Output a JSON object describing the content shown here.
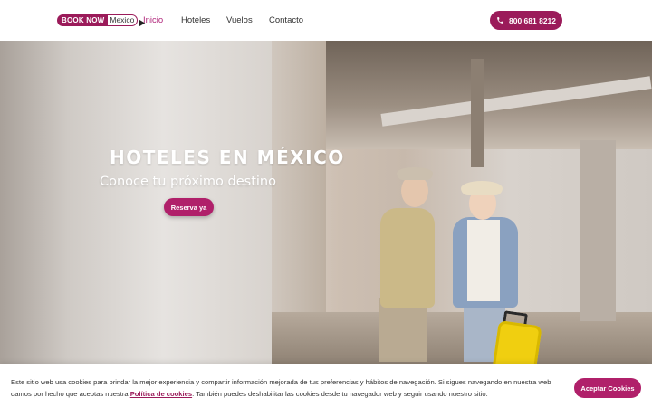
{
  "header": {
    "logo_left": "BOOK NOW",
    "logo_right": "Mexico",
    "nav": [
      {
        "label": "Inicio",
        "active": true
      },
      {
        "label": "Hoteles",
        "active": false
      },
      {
        "label": "Vuelos",
        "active": false
      },
      {
        "label": "Contacto",
        "active": false
      }
    ],
    "phone": "800 681 8212",
    "phone_icon": "phone-icon"
  },
  "hero": {
    "title": "HOTELES EN MÉXICO",
    "subtitle": "Conoce tu próximo destino",
    "cta": "Reserva ya"
  },
  "cookie": {
    "text_before": "Este sitio web usa cookies para brindar la mejor experiencia y compartir información mejorada de tus preferencias y hábitos de navegación. Si sigues navegando en nuestra web damos por hecho que aceptas nuestra ",
    "link": "Política de cookies",
    "text_after": ". También puedes deshabilitar las cookies desde tu navegador web y seguir usando nuestro sitio.",
    "accept": "Aceptar Cookies"
  },
  "colors": {
    "brand": "#9b1b5a",
    "accent": "#b0206a"
  }
}
